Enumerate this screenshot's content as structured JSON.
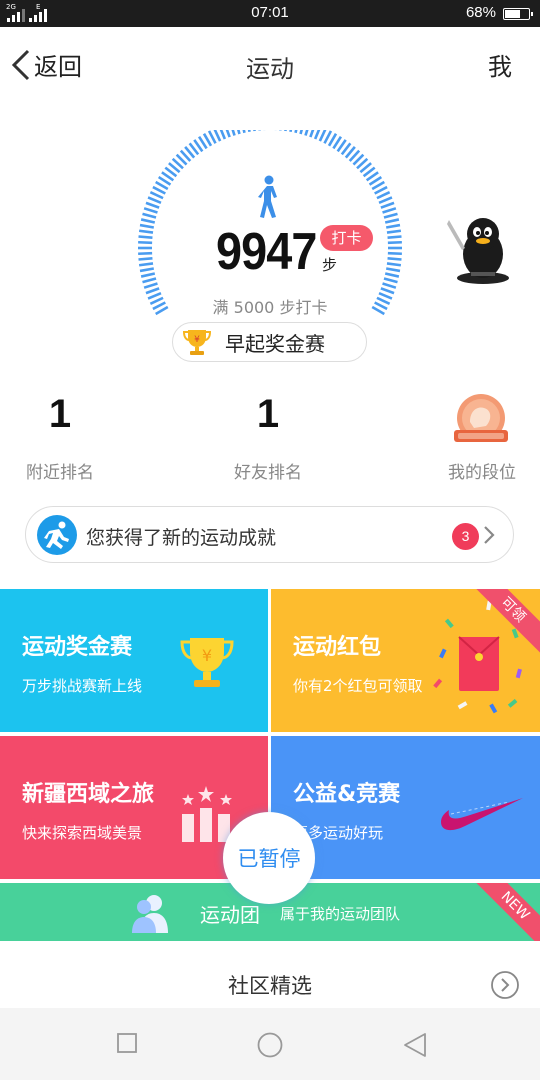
{
  "status_bar": {
    "signal_label": "2G",
    "network_label": "E",
    "time": "07:01",
    "battery_pct": "68%",
    "battery_level": 0.68
  },
  "header": {
    "back_label": "返回",
    "title": "运动",
    "me_label": "我"
  },
  "dial": {
    "steps": "9947",
    "step_unit": "步",
    "checkin_label": "打卡",
    "goal_text": "满 5000 步打卡",
    "race_label": "早起奖金赛"
  },
  "rankings": [
    {
      "value": "1",
      "label": "附近排名"
    },
    {
      "value": "1",
      "label": "好友排名"
    },
    {
      "value": "",
      "label": "我的段位"
    }
  ],
  "achievement": {
    "text": "您获得了新的运动成就",
    "count": "3"
  },
  "tiles": [
    {
      "title": "运动奖金赛",
      "subtitle": "万步挑战赛新上线",
      "color": "#1cc3ef"
    },
    {
      "title": "运动红包",
      "subtitle": "你有2个红包可领取",
      "color": "#fdbc2e",
      "corner": "可领"
    },
    {
      "title": "新疆西域之旅",
      "subtitle": "快来探索西域美景",
      "color": "#f34a6a"
    },
    {
      "title": "公益&竞赛",
      "subtitle": "更多运动好玩",
      "color": "#4a94f7"
    }
  ],
  "team": {
    "label": "运动团",
    "subtitle": "属于我的运动团队",
    "corner": "NEW",
    "color": "#48d19a"
  },
  "paused_label": "已暂停",
  "community_title": "社区精选",
  "icons": {
    "back": "back-chevron-icon",
    "walk": "walking-person-icon",
    "trophy": "trophy-icon",
    "penguin": "penguin-avatar-icon",
    "medal": "rank-medal-icon",
    "run": "running-man-icon",
    "chevron": "chevron-right-icon",
    "red_packet": "red-envelope-icon",
    "nike": "swoosh-icon",
    "podium": "podium-stars-icon",
    "team": "team-people-icon",
    "circle_more": "circle-chevron-icon"
  },
  "colors": {
    "accent_blue": "#2f8df0",
    "ring_blue": "#4a9cf0",
    "badge_red": "#f03c5a"
  }
}
